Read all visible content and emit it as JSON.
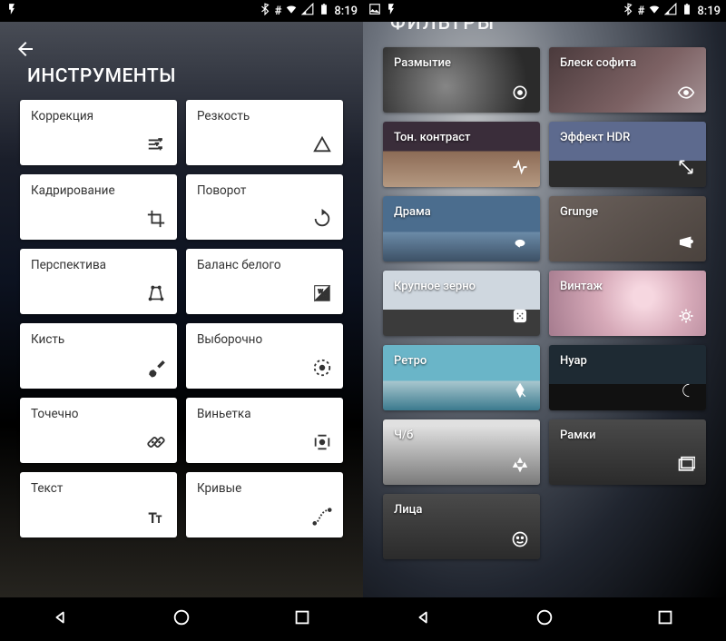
{
  "status": {
    "time": "8:19"
  },
  "left": {
    "title": "ИНСТРУМЕНТЫ",
    "tools": [
      {
        "label": "Коррекция",
        "icon": "tune-icon"
      },
      {
        "label": "Резкость",
        "icon": "details-icon"
      },
      {
        "label": "Кадрирование",
        "icon": "crop-icon"
      },
      {
        "label": "Поворот",
        "icon": "rotate-icon"
      },
      {
        "label": "Перспектива",
        "icon": "perspective-icon"
      },
      {
        "label": "Баланс белого",
        "icon": "white-balance-icon"
      },
      {
        "label": "Кисть",
        "icon": "brush-icon"
      },
      {
        "label": "Выборочно",
        "icon": "selective-icon"
      },
      {
        "label": "Точечно",
        "icon": "healing-icon"
      },
      {
        "label": "Виньетка",
        "icon": "vignette-icon"
      },
      {
        "label": "Текст",
        "icon": "text-icon"
      },
      {
        "label": "Кривые",
        "icon": "curves-icon"
      }
    ]
  },
  "right": {
    "title": "ФИЛЬТРЫ",
    "filters": [
      {
        "label": "Размытие",
        "icon": "blur-icon"
      },
      {
        "label": "Блеск софита",
        "icon": "glamour-icon"
      },
      {
        "label": "Тон. контраст",
        "icon": "tonal-icon"
      },
      {
        "label": "Эффект HDR",
        "icon": "hdr-icon"
      },
      {
        "label": "Драма",
        "icon": "drama-icon"
      },
      {
        "label": "Grunge",
        "icon": "grunge-icon"
      },
      {
        "label": "Крупное зерно",
        "icon": "grain-icon"
      },
      {
        "label": "Винтаж",
        "icon": "vintage-icon"
      },
      {
        "label": "Ретро",
        "icon": "retro-icon"
      },
      {
        "label": "Нуар",
        "icon": "noir-icon"
      },
      {
        "label": "Ч/б",
        "icon": "bw-icon"
      },
      {
        "label": "Рамки",
        "icon": "frames-icon"
      },
      {
        "label": "Лица",
        "icon": "faces-icon"
      }
    ]
  }
}
